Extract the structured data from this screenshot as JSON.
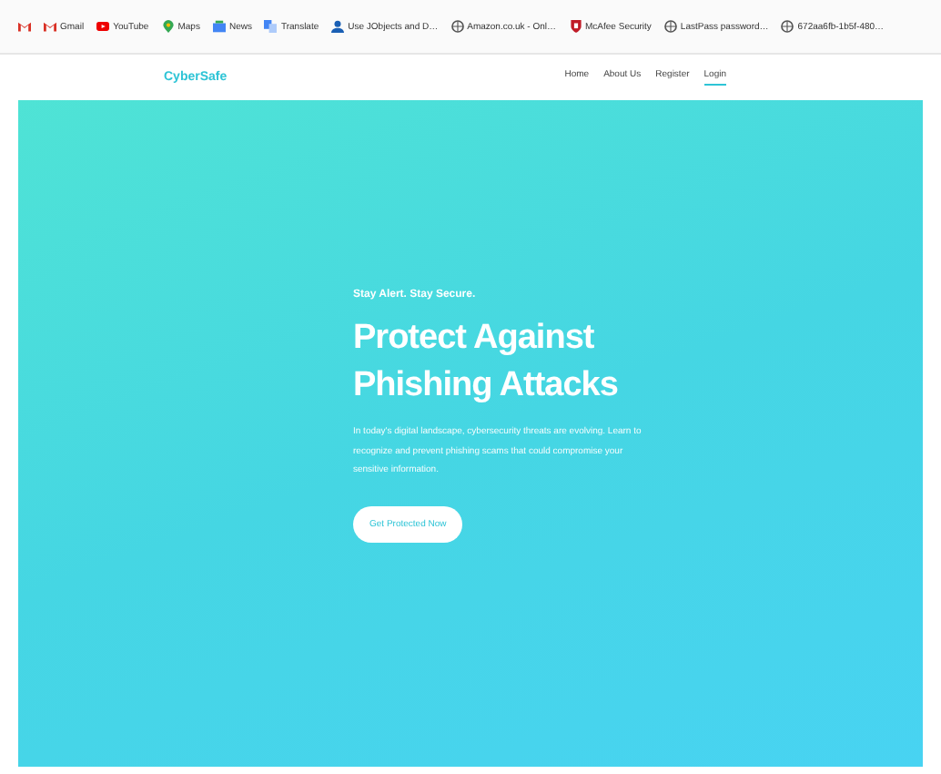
{
  "bookmarks": [
    {
      "kind": "mail"
    },
    {
      "label": "Gmail",
      "kind": "mail"
    },
    {
      "label": "YouTube",
      "kind": "video"
    },
    {
      "label": "Maps",
      "kind": "pin"
    },
    {
      "label": "News",
      "kind": "news"
    },
    {
      "label": "Translate",
      "kind": "translate"
    },
    {
      "label": "Use JObjects and D…",
      "kind": "person"
    },
    {
      "label": "Amazon.co.uk - Onl…",
      "kind": "globe"
    },
    {
      "label": "McAfee Security",
      "kind": "shield"
    },
    {
      "label": "LastPass password…",
      "kind": "globe"
    },
    {
      "label": "672aa6fb-1b5f-480…",
      "kind": "globe"
    }
  ],
  "nav": {
    "brand": "CyberSafe",
    "links": [
      {
        "label": "Home",
        "selected": false
      },
      {
        "label": "About Us",
        "selected": false
      },
      {
        "label": "Register",
        "selected": false
      },
      {
        "label": "Login",
        "selected": true
      }
    ]
  },
  "hero": {
    "eyebrow": "Stay Alert. Stay Secure.",
    "title": "Protect Against Phishing Attacks",
    "text": "In today's digital landscape, cybersecurity threats are evolving. Learn to recognize and prevent phishing scams that could compromise your sensitive information.",
    "button": "Get Protected Now"
  }
}
